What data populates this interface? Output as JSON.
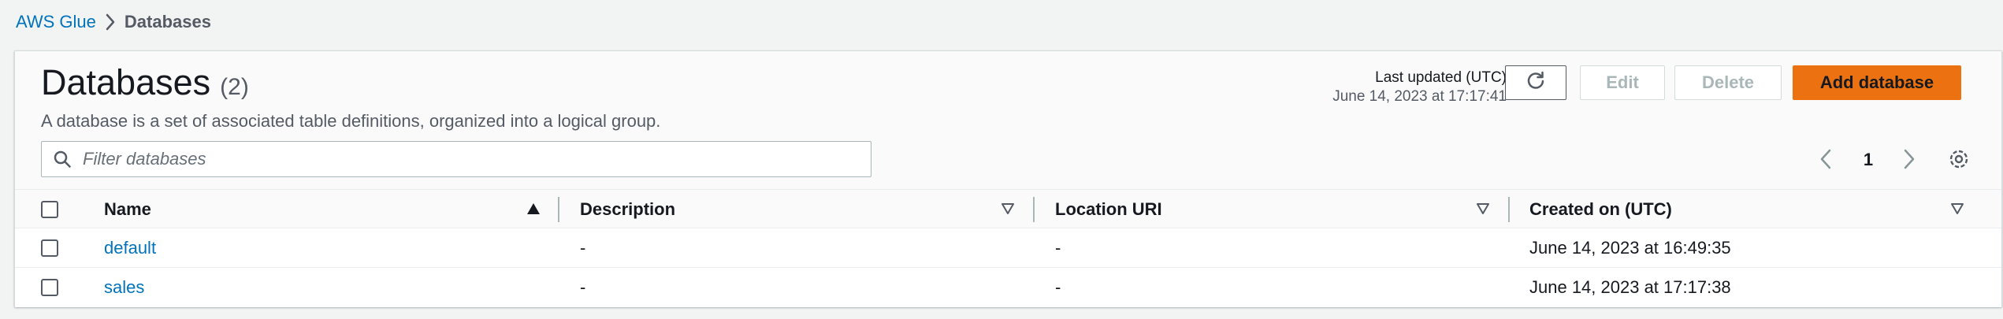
{
  "breadcrumb": {
    "root": "AWS Glue",
    "current": "Databases"
  },
  "header": {
    "title": "Databases",
    "count": "(2)",
    "description": "A database is a set of associated table definitions, organized into a logical group.",
    "last_updated_label": "Last updated (UTC)",
    "last_updated_value": "June 14, 2023 at 17:17:41"
  },
  "actions": {
    "refresh_icon": "refresh-icon",
    "edit_label": "Edit",
    "delete_label": "Delete",
    "add_label": "Add database"
  },
  "filter": {
    "placeholder": "Filter databases",
    "value": ""
  },
  "pagination": {
    "current_page": "1"
  },
  "table": {
    "columns": [
      "Name",
      "Description",
      "Location URI",
      "Created on (UTC)"
    ],
    "rows": [
      {
        "name": "default",
        "description": "-",
        "location": "-",
        "created": "June 14, 2023 at 16:49:35"
      },
      {
        "name": "sales",
        "description": "-",
        "location": "-",
        "created": "June 14, 2023 at 17:17:38"
      }
    ]
  },
  "colors": {
    "link": "#0073bb",
    "primary_button": "#ec7211",
    "disabled_text": "#aab7b8"
  }
}
